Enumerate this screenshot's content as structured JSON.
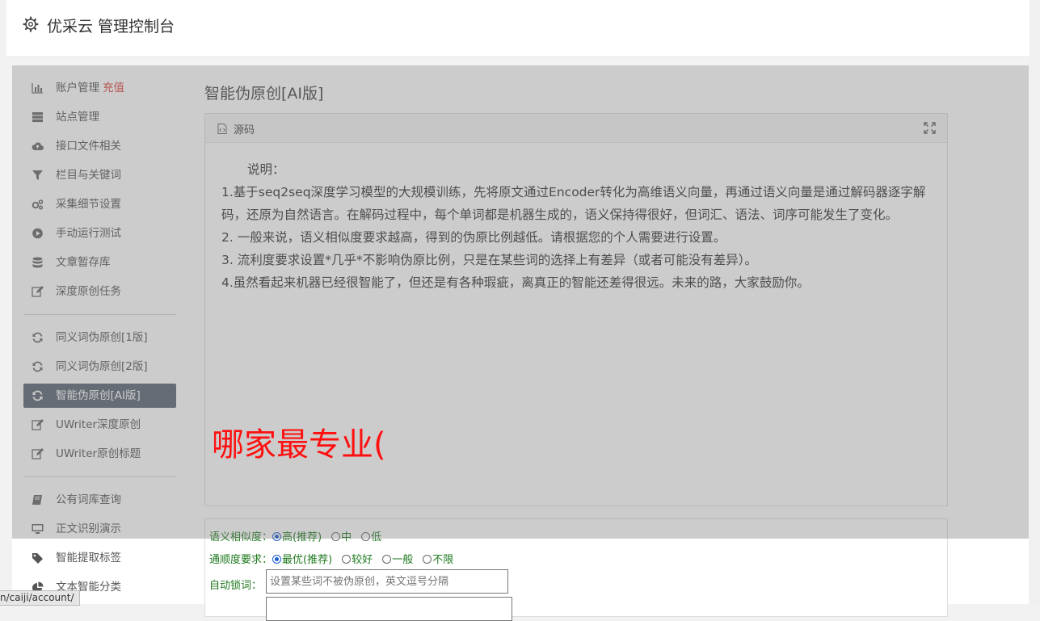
{
  "header": {
    "title": "优采云 管理控制台"
  },
  "sidebar": {
    "items": [
      {
        "label": "账户管理",
        "extra": "充值",
        "icon": "bar-chart-icon"
      },
      {
        "label": "站点管理",
        "icon": "server-icon"
      },
      {
        "label": "接口文件相关",
        "icon": "cloud-upload-icon"
      },
      {
        "label": "栏目与关键词",
        "icon": "filter-icon"
      },
      {
        "label": "采集细节设置",
        "icon": "cogs-icon"
      },
      {
        "label": "手动运行测试",
        "icon": "play-circle-icon"
      },
      {
        "label": "文章暂存库",
        "icon": "database-icon"
      },
      {
        "label": "深度原创任务",
        "icon": "edit-icon"
      },
      {
        "label": "同义词伪原创[1版]",
        "icon": "refresh-icon"
      },
      {
        "label": "同义词伪原创[2版]",
        "icon": "refresh-icon"
      },
      {
        "label": "智能伪原创[AI版]",
        "icon": "refresh-icon",
        "active": true
      },
      {
        "label": "UWriter深度原创",
        "icon": "edit-icon"
      },
      {
        "label": "UWriter原创标题",
        "icon": "edit-icon"
      },
      {
        "label": "公有词库查询",
        "icon": "book-icon"
      },
      {
        "label": "正文识别演示",
        "icon": "monitor-icon"
      },
      {
        "label": "智能提取标签",
        "icon": "tag-icon"
      },
      {
        "label": "文本智能分类",
        "icon": "pie-chart-icon"
      }
    ]
  },
  "main": {
    "title": "智能伪原创[AI版]",
    "panel": {
      "source_label": "源码",
      "note_title": "说明：",
      "lines": [
        "1.基于seq2seq深度学习模型的大规模训练，先将原文通过Encoder转化为高维语义向量，再通过语义向量是通过解码器逐字解码，还原为自然语言。在解码过程中，每个单词都是机器生成的，语义保持得很好，但词汇、语法、词序可能发生了变化。",
        "2. 一般来说，语义相似度要求越高，得到的伪原比例越低。请根据您的个人需要进行设置。",
        "3. 流利度要求设置*几乎*不影响伪原比例，只是在某些词的选择上有差异（或者可能没有差异）。",
        "4.虽然看起来机器已经很智能了，但还是有各种瑕疵，离真正的智能还差得很远。未来的路，大家鼓励你。"
      ]
    },
    "options": {
      "similarity": {
        "label": "语义相似度：",
        "choices": [
          "高(推荐)",
          "中",
          "低"
        ],
        "selected": "高(推荐)"
      },
      "fluency": {
        "label": "通顺度要求：",
        "choices": [
          "最优(推荐)",
          "较好",
          "一般",
          "不限"
        ],
        "selected": "最优(推荐)"
      },
      "lock": {
        "label": "自动锁词：",
        "placeholder": "设置某些词不被伪原创，英文逗号分隔"
      }
    }
  },
  "overlay": {
    "text": "哪家最专业("
  },
  "status_bar": {
    "url": "n/caiji/account/"
  }
}
